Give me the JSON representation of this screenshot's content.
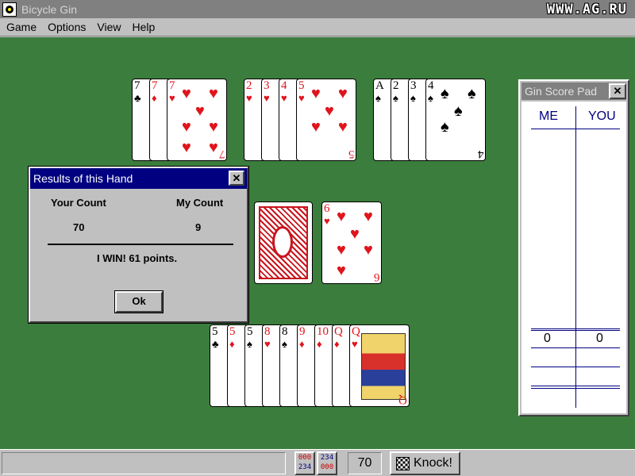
{
  "window": {
    "title": "Bicycle Gin",
    "watermark": "WWW.AG.RU"
  },
  "menu": [
    {
      "label": "Game"
    },
    {
      "label": "Options"
    },
    {
      "label": "View"
    },
    {
      "label": "Help"
    }
  ],
  "dialog": {
    "title": "Results of this Hand",
    "close": "✕",
    "your_count_label": "Your Count",
    "my_count_label": "My Count",
    "your_count": "70",
    "my_count": "9",
    "result": "I WIN!  61 points.",
    "ok_label": "Ok"
  },
  "scorepad": {
    "title": "Gin Score Pad",
    "close": "✕",
    "col_me": "ME",
    "col_you": "YOU",
    "me_total": "0",
    "you_total": "0"
  },
  "opponent_melds": [
    {
      "cards": [
        {
          "rank": "7",
          "suit": "♣",
          "color": "black"
        },
        {
          "rank": "7",
          "suit": "♦",
          "color": "red"
        },
        {
          "rank": "7",
          "suit": "♥",
          "color": "red"
        }
      ]
    },
    {
      "cards": [
        {
          "rank": "2",
          "suit": "♥",
          "color": "red"
        },
        {
          "rank": "3",
          "suit": "♥",
          "color": "red"
        },
        {
          "rank": "4",
          "suit": "♥",
          "color": "red"
        },
        {
          "rank": "5",
          "suit": "♥",
          "color": "red"
        }
      ]
    },
    {
      "cards": [
        {
          "rank": "A",
          "suit": "♠",
          "color": "black"
        },
        {
          "rank": "2",
          "suit": "♠",
          "color": "black"
        },
        {
          "rank": "3",
          "suit": "♠",
          "color": "black"
        },
        {
          "rank": "4",
          "suit": "♠",
          "color": "black"
        }
      ]
    }
  ],
  "discard": {
    "rank": "6",
    "suit": "♥",
    "color": "red"
  },
  "player_hand": [
    {
      "rank": "5",
      "suit": "♣",
      "color": "black"
    },
    {
      "rank": "5",
      "suit": "♦",
      "color": "red"
    },
    {
      "rank": "5",
      "suit": "♠",
      "color": "black"
    },
    {
      "rank": "8",
      "suit": "♥",
      "color": "red"
    },
    {
      "rank": "8",
      "suit": "♠",
      "color": "black"
    },
    {
      "rank": "9",
      "suit": "♦",
      "color": "red"
    },
    {
      "rank": "10",
      "suit": "♦",
      "color": "red"
    },
    {
      "rank": "Q",
      "suit": "♦",
      "color": "red"
    },
    {
      "rank": "Q",
      "suit": "♥",
      "color": "red"
    }
  ],
  "statusbar": {
    "message": "",
    "icon1_top": "000",
    "icon1_bottom": "234",
    "icon2_top": "234",
    "icon2_bottom": "000",
    "count": "70",
    "knock_label": "Knock!"
  }
}
